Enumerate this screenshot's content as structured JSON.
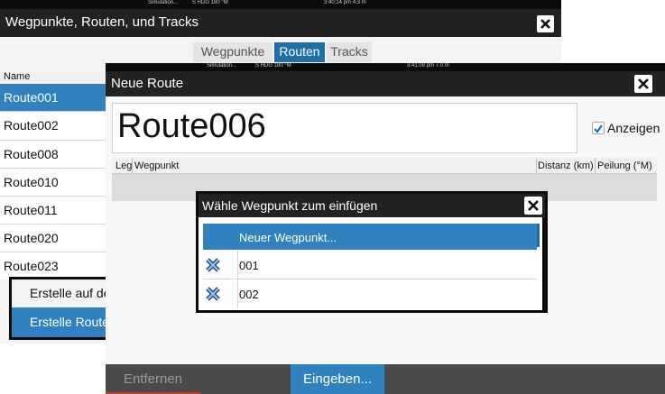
{
  "back_window": {
    "status": {
      "simulation": "Simulation...",
      "heading": "S HDG 180 °M",
      "time": "3:40:14 pm  4.3 m"
    },
    "title": "Wegpunkte, Routen, und Tracks",
    "close_icon": "close-icon",
    "tabs": [
      {
        "label": "Wegpunkte"
      },
      {
        "label": "Routen"
      },
      {
        "label": "Tracks"
      }
    ],
    "list_header": "Name",
    "routes": [
      "Route001",
      "Route002",
      "Route008",
      "Route010",
      "Route011",
      "Route020",
      "Route023"
    ],
    "buttons": {
      "create_on": "Erstelle auf de",
      "create_route": "Erstelle Route"
    }
  },
  "front_window": {
    "status": {
      "simulation": "Simulation...",
      "heading": "S HDG 180 °M",
      "time": "3:41:09 pm  7.0 m"
    },
    "title": "Neue Route",
    "route_name": "Route006",
    "show_label": "Anzeigen",
    "show_checked": true,
    "table_headers": {
      "leg": "Leg",
      "waypoint": "Wegpunkt",
      "distance": "Distanz (km)",
      "bearing": "Peilung (°M)"
    },
    "bottom": {
      "remove": "Entfernen",
      "enter": "Eingeben..."
    }
  },
  "popup": {
    "title": "Wähle Wegpunkt zum einfügen",
    "items": [
      {
        "label": "Neuer Wegpunkt...",
        "icon": ""
      },
      {
        "label": "001",
        "icon": "waypoint-icon"
      },
      {
        "label": "002",
        "icon": "waypoint-icon"
      }
    ]
  },
  "colors": {
    "accent": "#2f82be",
    "titlebar": "#222222",
    "bottom_bar": "#4a4a4a"
  }
}
